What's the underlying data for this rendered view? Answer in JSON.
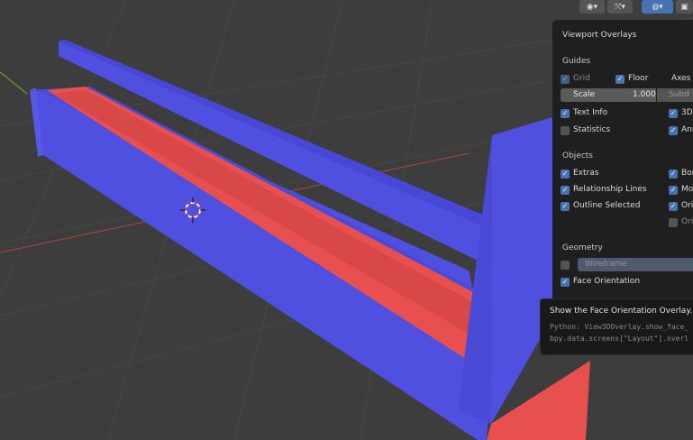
{
  "header": {
    "icons": [
      "visibility-icon",
      "gizmo-icon",
      "overlays-icon",
      "xray-icon"
    ],
    "overlays_active": true
  },
  "overlay_panel": {
    "title": "Viewport Overlays",
    "guides": {
      "heading": "Guides",
      "grid": "Grid",
      "floor": "Floor",
      "axes": "Axes",
      "scale_label": "Scale",
      "scale_value": "1.000",
      "subdivisions": "Subd",
      "text_info": "Text Info",
      "threed_cursor": "3D",
      "statistics": "Statistics",
      "annotations": "Ann"
    },
    "objects": {
      "heading": "Objects",
      "extras": "Extras",
      "bones": "Bon",
      "relationship_lines": "Relationship Lines",
      "motion_paths": "Mo",
      "outline_selected": "Outline Selected",
      "origins": "Orig",
      "origins_all": "Ori"
    },
    "geometry": {
      "heading": "Geometry",
      "wireframe": "Wireframe",
      "face_orientation": "Face Orientation"
    }
  },
  "tooltip": {
    "description": "Show the Face Orientation Overlay.",
    "python_line1": "Python: View3DOverlay.show_face_",
    "python_line2": "bpy.data.screens[\"Layout\"].overl"
  },
  "colors": {
    "front_face": "#5050e0",
    "back_face": "#e85050",
    "accent": "#4772b3",
    "background": "#3d3d3d"
  }
}
